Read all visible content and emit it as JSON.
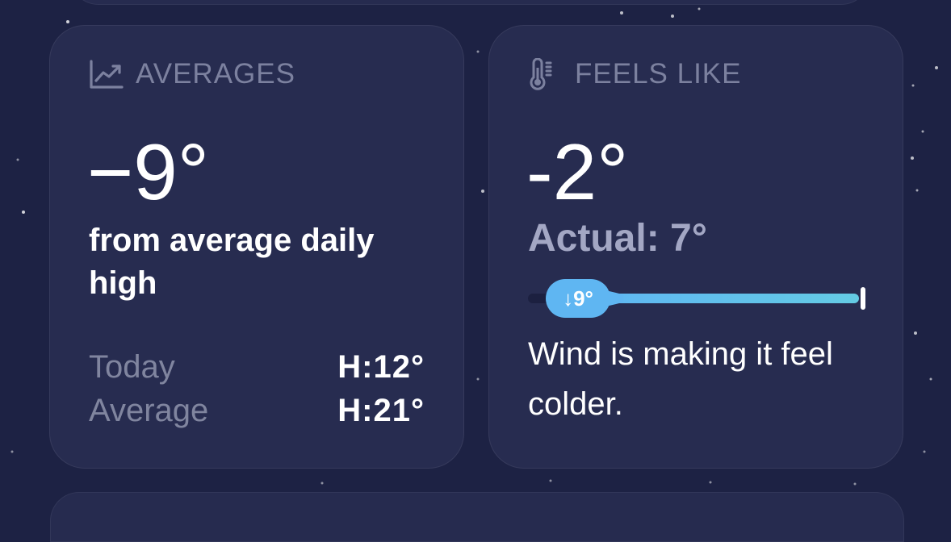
{
  "averages_card": {
    "title": "AVERAGES",
    "icon": "chart-line-icon",
    "value": "−9°",
    "subtext": "from average daily high",
    "rows": [
      {
        "label": "Today",
        "value": "H:12°"
      },
      {
        "label": "Average",
        "value": "H:21°"
      }
    ]
  },
  "feels_like_card": {
    "title": "FEELS LIKE",
    "icon": "thermometer-icon",
    "value": "-2°",
    "actual": "Actual: 7°",
    "gauge": {
      "badge": "↓9°",
      "difference": -9
    },
    "description": "Wind is making it feel colder."
  },
  "colors": {
    "background": "#1d2244",
    "card": "#272c50",
    "muted_text": "#7c819f",
    "accent": "#5fb6f2"
  }
}
